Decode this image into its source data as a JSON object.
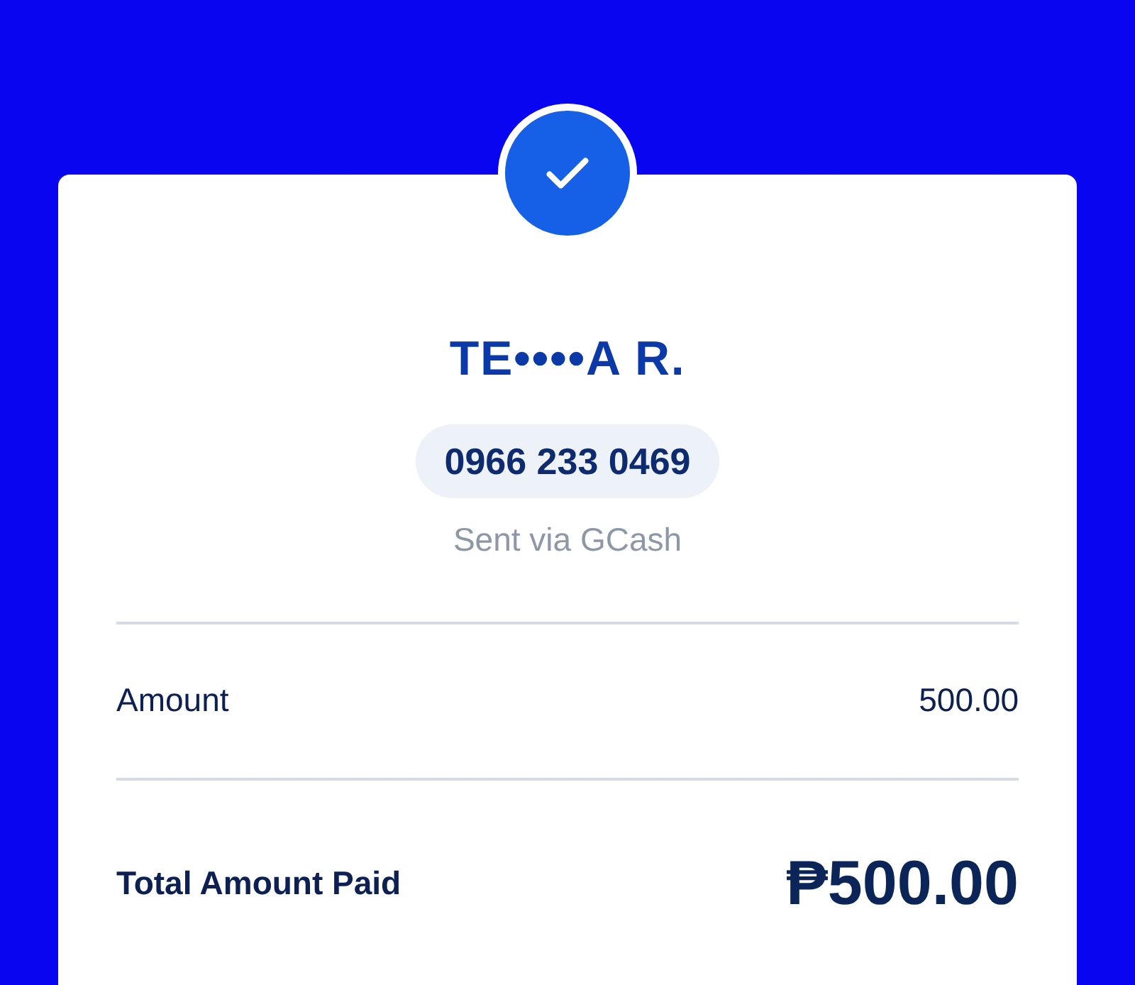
{
  "recipient": {
    "name": "TE••••A R.",
    "phone": "0966 233 0469",
    "via": "Sent via GCash"
  },
  "rows": [
    {
      "label": "Amount",
      "value": "500.00",
      "kind": "line"
    },
    {
      "label": "Total Amount Paid",
      "value": "₱500.00",
      "kind": "total"
    }
  ]
}
